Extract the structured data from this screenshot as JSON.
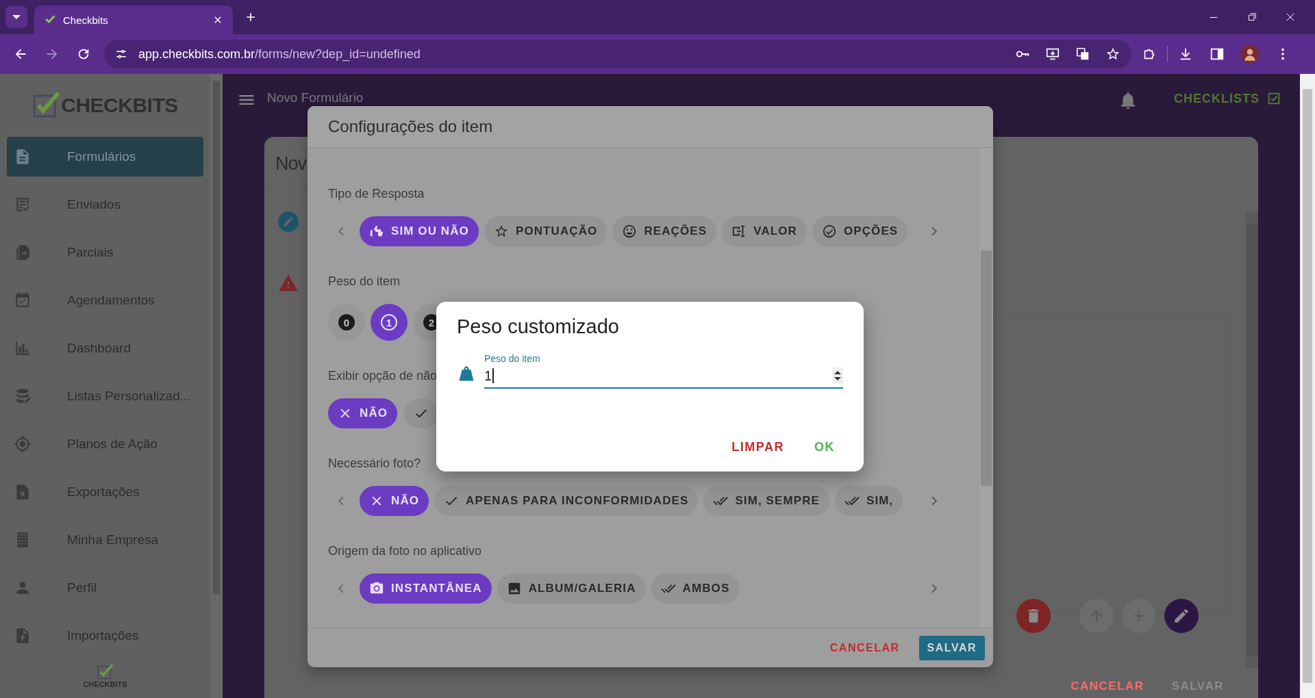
{
  "browser": {
    "tab_title": "Checkbits",
    "url_host": "app.checkbits.com.br",
    "url_path": "/forms/new?dep_id=undefined"
  },
  "sidebar": {
    "logo": "CHECKBITS",
    "items": [
      {
        "label": "Formulários",
        "selected": true
      },
      {
        "label": "Enviados",
        "selected": false
      },
      {
        "label": "Parciais",
        "selected": false
      },
      {
        "label": "Agendamentos",
        "selected": false
      },
      {
        "label": "Dashboard",
        "selected": false
      },
      {
        "label": "Listas Personalizad...",
        "selected": false
      },
      {
        "label": "Planos de Ação",
        "selected": false
      },
      {
        "label": "Exportações",
        "selected": false
      },
      {
        "label": "Minha Empresa",
        "selected": false
      },
      {
        "label": "Perfil",
        "selected": false
      },
      {
        "label": "Importações",
        "selected": false
      }
    ],
    "footer_logo": "CHECKBITS"
  },
  "topbar": {
    "title": "Novo Formulário",
    "action": "CHECKLISTS"
  },
  "page": {
    "title": "Nov",
    "buttons": [
      {
        "label": "CANCELAR",
        "kind": "danger"
      },
      {
        "label": "SALVAR",
        "kind": "disabled"
      }
    ]
  },
  "config_dialog": {
    "title": "Configurações do item",
    "sections": [
      {
        "kind": "slide",
        "label": "Tipo de Resposta",
        "chips": [
          {
            "label": "SIM OU NÃO",
            "selected": true
          },
          {
            "label": "PONTUAÇÃO",
            "selected": false
          },
          {
            "label": "REAÇÕES",
            "selected": false
          },
          {
            "label": "VALOR",
            "selected": false
          },
          {
            "label": "OPÇÕES",
            "selected": false
          }
        ]
      },
      {
        "kind": "weights",
        "label": "Peso do item",
        "chips": [
          {
            "label": "0",
            "selected": false
          },
          {
            "label": "1",
            "selected": true
          },
          {
            "label": "2",
            "selected": false
          }
        ]
      },
      {
        "kind": "toggle",
        "label": "Exibir opção de não",
        "chips": [
          {
            "label": "NÃO",
            "selected": true
          },
          {
            "selected": false
          }
        ]
      },
      {
        "kind": "slide",
        "label": "Necessário foto?",
        "chips": [
          {
            "label": "NÃO",
            "selected": true
          },
          {
            "label": "APENAS PARA INCONFORMIDADES",
            "selected": false
          },
          {
            "label": "SIM, SEMPRE",
            "selected": false
          },
          {
            "label": "SIM,",
            "selected": false
          }
        ]
      },
      {
        "kind": "slide",
        "label": "Origem da foto no aplicativo",
        "chips": [
          {
            "label": "INSTANTÂNEA",
            "selected": true
          },
          {
            "label": "ALBUM/GALERIA",
            "selected": false
          },
          {
            "label": "AMBOS",
            "selected": false
          }
        ]
      }
    ],
    "buttons": [
      {
        "label": "CANCELAR",
        "kind": "danger"
      },
      {
        "label": "SALVAR",
        "kind": "primary"
      }
    ]
  },
  "weight_dialog": {
    "title": "Peso customizado",
    "field": {
      "label": "Peso do item",
      "value": "1"
    },
    "buttons": [
      {
        "label": "LIMPAR",
        "kind": "danger"
      },
      {
        "label": "OK",
        "kind": "confirm"
      }
    ]
  }
}
